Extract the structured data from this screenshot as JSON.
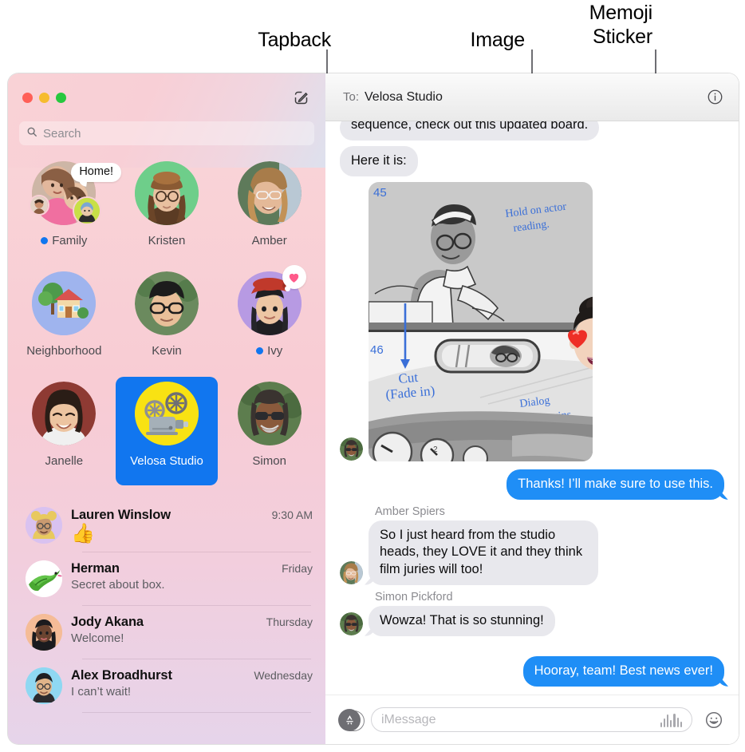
{
  "annotations": [
    {
      "id": "tapback",
      "label": "Tapback"
    },
    {
      "id": "image",
      "label": "Image"
    },
    {
      "id": "memoji",
      "label": "Memoji\nSticker"
    }
  ],
  "window": {
    "traffic_lights": {
      "close": "close-button",
      "minimize": "minimize-button",
      "zoom": "zoom-button"
    },
    "compose_tooltip": "New Message"
  },
  "sidebar": {
    "search": {
      "placeholder": "Search",
      "value": ""
    },
    "pinned": [
      {
        "name": "Family",
        "unread": true,
        "type": "group",
        "tapback_text": "Home!",
        "emoji": ""
      },
      {
        "name": "Kristen",
        "unread": false,
        "type": "memoji",
        "emoji": "👩‍🦱"
      },
      {
        "name": "Amber",
        "unread": false,
        "type": "photo",
        "emoji": "👩"
      },
      {
        "name": "Neighborhood",
        "unread": false,
        "type": "emoji",
        "emoji": "🏡"
      },
      {
        "name": "Kevin",
        "unread": false,
        "type": "photo",
        "emoji": "👨"
      },
      {
        "name": "Ivy",
        "unread": true,
        "type": "memoji",
        "emoji": "👩",
        "tapback": "heart"
      },
      {
        "name": "Janelle",
        "unread": false,
        "type": "photo",
        "emoji": "👩"
      },
      {
        "name": "Velosa Studio",
        "unread": false,
        "type": "emoji",
        "emoji": "📽️",
        "selected": true
      },
      {
        "name": "Simon",
        "unread": false,
        "type": "photo",
        "emoji": "👨🏾"
      }
    ],
    "conversations": [
      {
        "name": "Lauren Winslow",
        "time": "9:30 AM",
        "preview": "👍",
        "preview_is_emoji": true,
        "avatar": "👱‍♀️"
      },
      {
        "name": "Herman",
        "time": "Friday",
        "preview": "Secret about box.",
        "preview_is_emoji": false,
        "avatar": "🦎"
      },
      {
        "name": "Jody Akana",
        "time": "Thursday",
        "preview": "Welcome!",
        "preview_is_emoji": false,
        "avatar": "👩🏿"
      },
      {
        "name": "Alex Broadhurst",
        "time": "Wednesday",
        "preview": "I can’t wait!",
        "preview_is_emoji": false,
        "avatar": "👨🏻"
      }
    ]
  },
  "thread": {
    "to_label": "To:",
    "recipient": "Velosa Studio",
    "info_button": "Details",
    "messages": [
      {
        "kind": "text",
        "dir": "in",
        "sender": "",
        "text": "sequence, check out this updated board.",
        "clipped_top": true
      },
      {
        "kind": "text",
        "dir": "in",
        "sender": "",
        "text": "Here it is:"
      },
      {
        "kind": "image",
        "dir": "in",
        "sender": "",
        "image_title": "Storyboard panel",
        "annotations_in_image": [
          "45",
          "Hold on actor reading.",
          "46",
          "Cut (Fade in)",
          "Dialog Begins Here"
        ],
        "sticker": "memoji-heart-eyes"
      },
      {
        "kind": "text",
        "dir": "out",
        "sender": "",
        "text": "Thanks! I’ll make sure to use this."
      },
      {
        "kind": "text",
        "dir": "in",
        "sender": "Amber Spiers",
        "text": "So I just heard from the studio heads, they LOVE it and they think film juries will too!"
      },
      {
        "kind": "text",
        "dir": "in",
        "sender": "Simon Pickford",
        "text": "Wowza! That is so stunning!"
      },
      {
        "kind": "text",
        "dir": "out",
        "sender": "",
        "text": "Hooray, team! Best news ever!"
      }
    ],
    "compose": {
      "placeholder": "iMessage",
      "value": "",
      "apps_button": "App Store",
      "audio_button": "Record Audio",
      "emoji_button": "Emoji Picker"
    }
  },
  "colors": {
    "outgoing_bubble": "#1f8ef6",
    "incoming_bubble": "#e8e8ed",
    "selected_pin": "#1176ef",
    "unread_dot": "#1176ef",
    "tapback_heart": "#ff5a8a",
    "leader_line": "#6e6e73"
  }
}
